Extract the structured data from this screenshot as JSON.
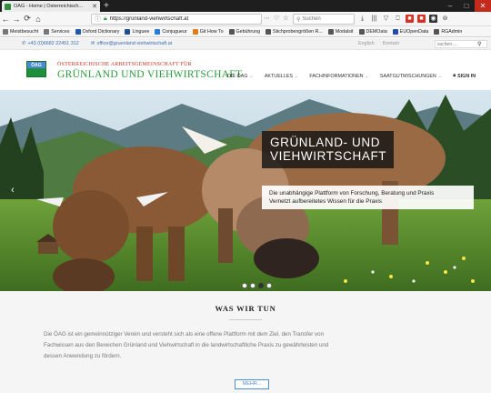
{
  "browser": {
    "tab_title": "ÖAG - Home | Österreichisch...",
    "tab_close": "✕",
    "newtab": "+",
    "url": "https://grünland-viehwirtschaft.at",
    "url_actions": "⋯ ♡ ☆",
    "search_placeholder": "Suchen",
    "nav": [
      "←",
      "→",
      "⟳",
      "⌂"
    ],
    "toolbar_icons": [
      "⤓",
      "|||",
      "▽",
      "⎕",
      "■",
      "■",
      "◉",
      "⊚"
    ],
    "bookmarks": [
      {
        "label": "Meistbesucht",
        "color": "#777777"
      },
      {
        "label": "Services",
        "color": "#777777"
      },
      {
        "label": "Oxford Dictionary",
        "color": "#1e5aa8"
      },
      {
        "label": "Linguee",
        "color": "#1f4f8f"
      },
      {
        "label": "Conjugueur",
        "color": "#2b7bd1"
      },
      {
        "label": "Git How To",
        "color": "#e07b1a"
      },
      {
        "label": "Gebührung",
        "color": "#555555"
      },
      {
        "label": "Stichprobengrößen R...",
        "color": "#555555"
      },
      {
        "label": "Modalsit",
        "color": "#555555"
      },
      {
        "label": "DEMOata",
        "color": "#555555"
      },
      {
        "label": "EUOpenData",
        "color": "#1e4fa0"
      },
      {
        "label": "RGAdmin",
        "color": "#555555"
      }
    ]
  },
  "contact": {
    "phone": "+43 (0)6682 22451 312",
    "email": "office@gruenland-viehwirtschaft.at",
    "langs": [
      "English",
      "Kontakt"
    ],
    "search_placeholder": "suchen ..."
  },
  "header": {
    "logo_text": "ÖAG",
    "brand_line1": "ÖSTERREICHISCHE ARBEITSGEMEINSCHAFT FÜR",
    "brand_line2": "GRÜNLAND UND VIEHWIRTSCHAFT",
    "nav": [
      {
        "label": "DIE ÖAG"
      },
      {
        "label": "AKTUELLES"
      },
      {
        "label": "FACHINFORMATIONEN"
      },
      {
        "label": "SAATGUTMISCHUNGEN"
      }
    ],
    "signin": "SIGN IN"
  },
  "hero": {
    "title_line1": "GRÜNLAND- UND",
    "title_line2": "VIEHWIRTSCHAFT",
    "subtitle_line1": "Die unabhängige Plattform von Forschung, Beratung und Praxis",
    "subtitle_line2": "Vernetzt aufbereitetes Wissen für die Praxis",
    "prev_arrow": "‹",
    "slides": 4,
    "active_slide": 2
  },
  "section": {
    "title": "WAS WIR TUN",
    "lines": [
      "Die ÖAG ist ein gemeinnütziger Verein und versteht sich als eine offene Plattform mit dem Ziel, den Transfer von",
      "Fachwissen aus den Bereichen Grünland und Viehwirtschaft in die landwirtschaftliche Praxis zu gewährleisten und",
      "dessen Anwendung zu fördern."
    ],
    "more_label": "MEHR..."
  }
}
